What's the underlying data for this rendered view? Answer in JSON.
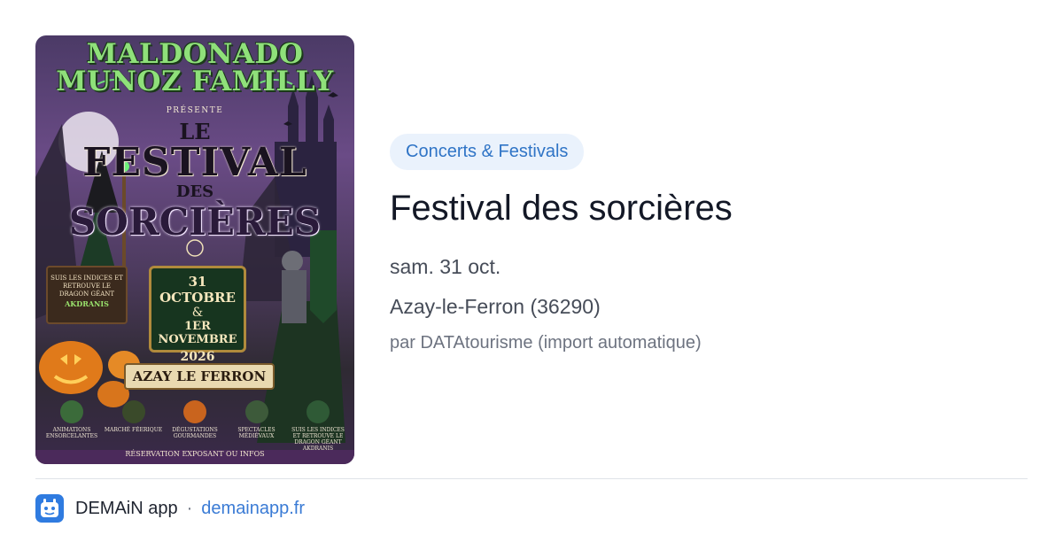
{
  "poster": {
    "brand": "MALDONADO MUNOZ FAMILLY",
    "presente": "PRÉSENTE",
    "title_le": "LE",
    "title_festival": "FESTIVAL",
    "title_des": "DES",
    "title_sorcieres": "SORCIÈRES",
    "clue_sign_text": "SUIS LES INDICES ET RETROUVE LE DRAGON GÉANT",
    "clue_sign_name": "AKDRANIS",
    "date_line1": "31 OCTOBRE",
    "date_amp": "&",
    "date_line2": "1ER NOVEMBRE",
    "date_year": "2026",
    "place": "AZAY LE FERRON",
    "activities": [
      "ANIMATIONS ENSORCELANTES",
      "MARCHÉ FÉERIQUE",
      "DÉGUSTATIONS GOURMANDES",
      "SPECTACLES MÉDIÉVAUX",
      "SUIS LES INDICES ET RETROUVE LE DRAGON GÉANT AKDRANIS"
    ],
    "footer": "RÉSERVATION EXPOSANT OU INFOS"
  },
  "category": "Concerts & Festivals",
  "event_title": "Festival des sorcières",
  "event_date": "sam. 31 oct.",
  "event_location": "Azay-le-Ferron (36290)",
  "event_source": "par DATAtourisme (import automatique)",
  "footer": {
    "app_name": "DEMAiN app",
    "separator": "·",
    "app_url": "demainapp.fr"
  },
  "colors": {
    "accent": "#2f74c6",
    "chip_bg": "#eaf2fc",
    "app_icon": "#2f7be0"
  }
}
